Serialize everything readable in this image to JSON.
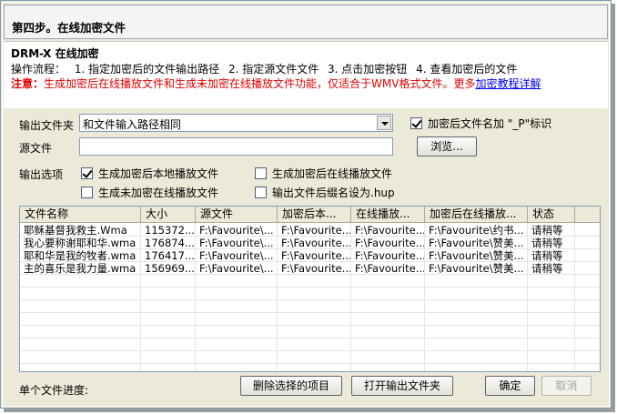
{
  "window": {
    "title": "第四步。在线加密文件"
  },
  "info": {
    "heading": "DRM-X 在线加密",
    "steps_label": "操作流程：",
    "steps": [
      "1. 指定加密后的文件输出路径",
      "2. 指定源文件文件",
      "3. 点击加密按钮",
      "4. 查看加密后的文件"
    ],
    "note_label": "注意：",
    "note_text": "生成加密后在线播放文件和生成未加密在线播放文件功能，仅适合于WMV格式文件。更多",
    "note_link": "加密教程详解"
  },
  "form": {
    "output_folder_label": "输出文件夹",
    "output_folder_value": "和文件输入路径相同",
    "add_p_label": "加密后文件名加 \"_P\"标识",
    "add_p_checked": true,
    "source_label": "源文件",
    "source_value": "",
    "browse_label": "浏览...",
    "options_label": "输出选项",
    "options": [
      {
        "label": "生成加密后本地播放文件",
        "checked": true
      },
      {
        "label": "生成加密后在线播放文件",
        "checked": false
      },
      {
        "label": "生成未加密在线播放文件",
        "checked": false
      },
      {
        "label": "输出文件后缀名设为.hup",
        "checked": false
      }
    ]
  },
  "table": {
    "columns": [
      "文件名称",
      "大小",
      "源文件",
      "加密后本...",
      "在线播放...",
      "加密后在线播放...",
      "状态"
    ],
    "rows": [
      [
        "耶稣基督我救主.Wma",
        "115372...",
        "F:\\Favourite\\...",
        "F:\\Favourite...",
        "F:\\Favourite...",
        "F:\\Favourite\\约书...",
        "请稍等"
      ],
      [
        "我心要称谢耶和华.wma",
        "176874...",
        "F:\\Favourite\\...",
        "F:\\Favourite...",
        "F:\\Favourite...",
        "F:\\Favourite\\赞美...",
        "请稍等"
      ],
      [
        "耶和华是我的牧者.wma",
        "176417...",
        "F:\\Favourite\\...",
        "F:\\Favourite...",
        "F:\\Favourite...",
        "F:\\Favourite\\赞美...",
        "请稍等"
      ],
      [
        "主的喜乐是我力量.wma",
        "156969...",
        "F:\\Favourite\\...",
        "F:\\Favourite...",
        "F:\\Favourite...",
        "F:\\Favourite\\赞美...",
        "请稍等"
      ]
    ]
  },
  "footer": {
    "progress_label": "单个文件进度:",
    "delete_label": "删除选择的项目",
    "open_output_label": "打开输出文件夹",
    "ok_label": "确定",
    "cancel_label": "取消"
  }
}
